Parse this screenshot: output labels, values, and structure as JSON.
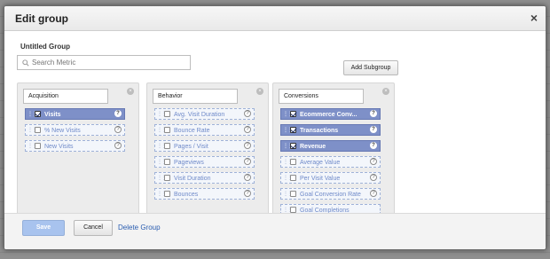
{
  "dialog": {
    "title": "Edit group",
    "close_glyph": "×",
    "group_name": "Untitled Group"
  },
  "search": {
    "placeholder": "Search Metric",
    "value": "",
    "icon": "search-icon"
  },
  "add_subgroup_label": "Add Subgroup",
  "subgroups": [
    {
      "name": "Acquisition",
      "metrics": [
        {
          "label": "Visits",
          "checked": true
        },
        {
          "label": "% New Visits",
          "checked": false
        },
        {
          "label": "New Visits",
          "checked": false
        }
      ]
    },
    {
      "name": "Behavior",
      "metrics": [
        {
          "label": "Avg. Visit Duration",
          "checked": false
        },
        {
          "label": "Bounce Rate",
          "checked": false
        },
        {
          "label": "Pages / Visit",
          "checked": false
        },
        {
          "label": "Pageviews",
          "checked": false
        },
        {
          "label": "Visit Duration",
          "checked": false
        },
        {
          "label": "Bounces",
          "checked": false
        }
      ]
    },
    {
      "name": "Conversions",
      "metrics": [
        {
          "label": "Ecommerce Conv...",
          "checked": true
        },
        {
          "label": "Transactions",
          "checked": true
        },
        {
          "label": "Revenue",
          "checked": true
        },
        {
          "label": "Average Value",
          "checked": false
        },
        {
          "label": "Per Visit Value",
          "checked": false
        },
        {
          "label": "Goal Conversion Rate",
          "checked": false
        },
        {
          "label": "Goal Completions",
          "checked": false
        }
      ]
    }
  ],
  "help_glyph": "?",
  "remove_glyph": "×",
  "footer": {
    "save_label": "Save",
    "cancel_label": "Cancel",
    "delete_label": "Delete Group"
  },
  "colors": {
    "selected_metric": "#7e90c8",
    "link": "#2a5db0",
    "save_button": "#a8c3ee"
  }
}
